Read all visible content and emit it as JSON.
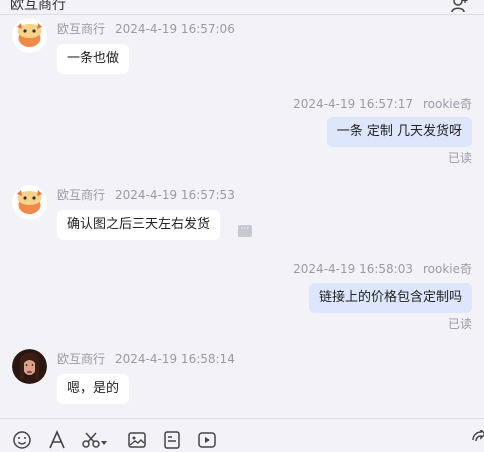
{
  "header": {
    "title": "欧互商行"
  },
  "messages": [
    {
      "direction": "in",
      "sender": "欧互商行",
      "time": "2024-4-19 16:57:06",
      "text": "一条也做"
    },
    {
      "direction": "out",
      "sender": "rookie奇",
      "time": "2024-4-19 16:57:17",
      "text": "一条 定制  几天发货呀",
      "status": "已读"
    },
    {
      "direction": "in",
      "sender": "欧互商行",
      "time": "2024-4-19 16:57:53",
      "text": "确认图之后三天左右发货"
    },
    {
      "direction": "out",
      "sender": "rookie奇",
      "time": "2024-4-19 16:58:03",
      "text": "链接上的价格包含定制吗",
      "status": "已读"
    },
    {
      "direction": "in",
      "sender": "欧互商行",
      "time": "2024-4-19 16:58:14",
      "text": "嗯，是的"
    }
  ],
  "toolbar": {
    "icons": [
      "emoji-icon",
      "font-icon",
      "scissors-icon",
      "image-icon",
      "file-icon",
      "video-icon",
      "send-icon"
    ]
  },
  "colors": {
    "background": "#f3f3f7",
    "incoming_bubble": "#ffffff",
    "outgoing_bubble": "#dde6fb",
    "meta_text": "#9a9aa6"
  }
}
